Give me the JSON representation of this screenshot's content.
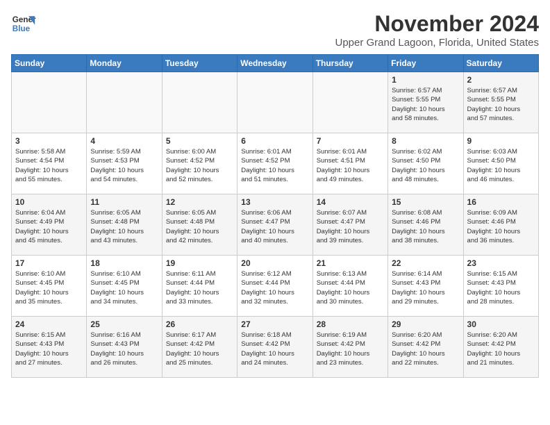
{
  "header": {
    "logo_line1": "General",
    "logo_line2": "Blue",
    "title": "November 2024",
    "subtitle": "Upper Grand Lagoon, Florida, United States"
  },
  "weekdays": [
    "Sunday",
    "Monday",
    "Tuesday",
    "Wednesday",
    "Thursday",
    "Friday",
    "Saturday"
  ],
  "weeks": [
    [
      {
        "day": "",
        "info": ""
      },
      {
        "day": "",
        "info": ""
      },
      {
        "day": "",
        "info": ""
      },
      {
        "day": "",
        "info": ""
      },
      {
        "day": "",
        "info": ""
      },
      {
        "day": "1",
        "info": "Sunrise: 6:57 AM\nSunset: 5:55 PM\nDaylight: 10 hours\nand 58 minutes."
      },
      {
        "day": "2",
        "info": "Sunrise: 6:57 AM\nSunset: 5:55 PM\nDaylight: 10 hours\nand 57 minutes."
      }
    ],
    [
      {
        "day": "3",
        "info": "Sunrise: 5:58 AM\nSunset: 4:54 PM\nDaylight: 10 hours\nand 55 minutes."
      },
      {
        "day": "4",
        "info": "Sunrise: 5:59 AM\nSunset: 4:53 PM\nDaylight: 10 hours\nand 54 minutes."
      },
      {
        "day": "5",
        "info": "Sunrise: 6:00 AM\nSunset: 4:52 PM\nDaylight: 10 hours\nand 52 minutes."
      },
      {
        "day": "6",
        "info": "Sunrise: 6:01 AM\nSunset: 4:52 PM\nDaylight: 10 hours\nand 51 minutes."
      },
      {
        "day": "7",
        "info": "Sunrise: 6:01 AM\nSunset: 4:51 PM\nDaylight: 10 hours\nand 49 minutes."
      },
      {
        "day": "8",
        "info": "Sunrise: 6:02 AM\nSunset: 4:50 PM\nDaylight: 10 hours\nand 48 minutes."
      },
      {
        "day": "9",
        "info": "Sunrise: 6:03 AM\nSunset: 4:50 PM\nDaylight: 10 hours\nand 46 minutes."
      }
    ],
    [
      {
        "day": "10",
        "info": "Sunrise: 6:04 AM\nSunset: 4:49 PM\nDaylight: 10 hours\nand 45 minutes."
      },
      {
        "day": "11",
        "info": "Sunrise: 6:05 AM\nSunset: 4:48 PM\nDaylight: 10 hours\nand 43 minutes."
      },
      {
        "day": "12",
        "info": "Sunrise: 6:05 AM\nSunset: 4:48 PM\nDaylight: 10 hours\nand 42 minutes."
      },
      {
        "day": "13",
        "info": "Sunrise: 6:06 AM\nSunset: 4:47 PM\nDaylight: 10 hours\nand 40 minutes."
      },
      {
        "day": "14",
        "info": "Sunrise: 6:07 AM\nSunset: 4:47 PM\nDaylight: 10 hours\nand 39 minutes."
      },
      {
        "day": "15",
        "info": "Sunrise: 6:08 AM\nSunset: 4:46 PM\nDaylight: 10 hours\nand 38 minutes."
      },
      {
        "day": "16",
        "info": "Sunrise: 6:09 AM\nSunset: 4:46 PM\nDaylight: 10 hours\nand 36 minutes."
      }
    ],
    [
      {
        "day": "17",
        "info": "Sunrise: 6:10 AM\nSunset: 4:45 PM\nDaylight: 10 hours\nand 35 minutes."
      },
      {
        "day": "18",
        "info": "Sunrise: 6:10 AM\nSunset: 4:45 PM\nDaylight: 10 hours\nand 34 minutes."
      },
      {
        "day": "19",
        "info": "Sunrise: 6:11 AM\nSunset: 4:44 PM\nDaylight: 10 hours\nand 33 minutes."
      },
      {
        "day": "20",
        "info": "Sunrise: 6:12 AM\nSunset: 4:44 PM\nDaylight: 10 hours\nand 32 minutes."
      },
      {
        "day": "21",
        "info": "Sunrise: 6:13 AM\nSunset: 4:44 PM\nDaylight: 10 hours\nand 30 minutes."
      },
      {
        "day": "22",
        "info": "Sunrise: 6:14 AM\nSunset: 4:43 PM\nDaylight: 10 hours\nand 29 minutes."
      },
      {
        "day": "23",
        "info": "Sunrise: 6:15 AM\nSunset: 4:43 PM\nDaylight: 10 hours\nand 28 minutes."
      }
    ],
    [
      {
        "day": "24",
        "info": "Sunrise: 6:15 AM\nSunset: 4:43 PM\nDaylight: 10 hours\nand 27 minutes."
      },
      {
        "day": "25",
        "info": "Sunrise: 6:16 AM\nSunset: 4:43 PM\nDaylight: 10 hours\nand 26 minutes."
      },
      {
        "day": "26",
        "info": "Sunrise: 6:17 AM\nSunset: 4:42 PM\nDaylight: 10 hours\nand 25 minutes."
      },
      {
        "day": "27",
        "info": "Sunrise: 6:18 AM\nSunset: 4:42 PM\nDaylight: 10 hours\nand 24 minutes."
      },
      {
        "day": "28",
        "info": "Sunrise: 6:19 AM\nSunset: 4:42 PM\nDaylight: 10 hours\nand 23 minutes."
      },
      {
        "day": "29",
        "info": "Sunrise: 6:20 AM\nSunset: 4:42 PM\nDaylight: 10 hours\nand 22 minutes."
      },
      {
        "day": "30",
        "info": "Sunrise: 6:20 AM\nSunset: 4:42 PM\nDaylight: 10 hours\nand 21 minutes."
      }
    ]
  ]
}
